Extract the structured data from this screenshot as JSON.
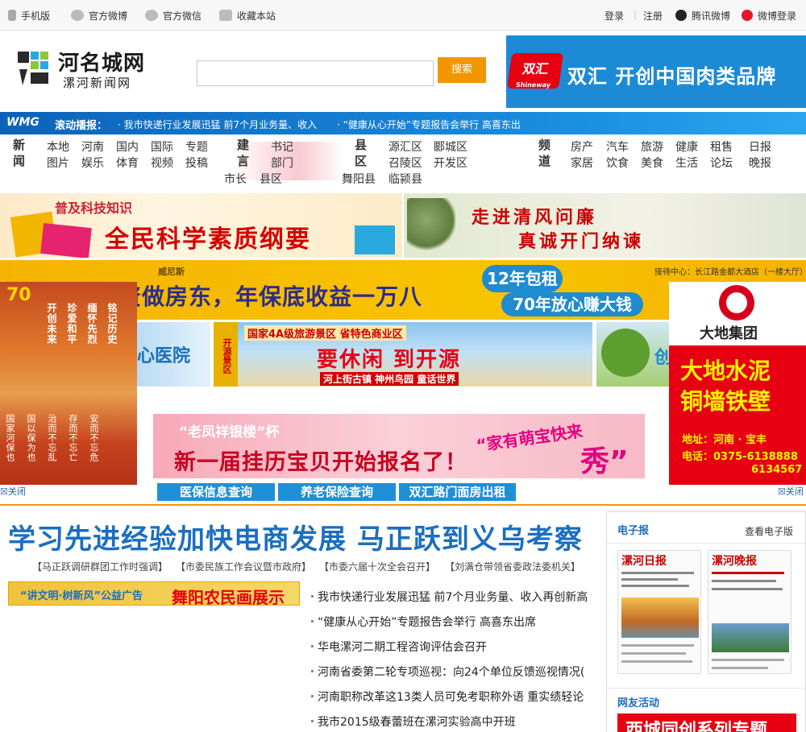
{
  "topbar": {
    "mobile": "手机版",
    "weibo": "官方微博",
    "wechat": "官方微信",
    "bookmark": "收藏本站",
    "login": "登录",
    "register": "注册",
    "tencent_weibo": "腾讯微博",
    "weibo_login": "微博登录"
  },
  "header": {
    "logo_title": "河名城网",
    "logo_subtitle": "漯河新闻网",
    "search_value": "",
    "search_button": "搜索",
    "ad_brand": "双汇",
    "ad_brand_en": "Shineway",
    "ad_text": "双汇  开创中国肉类品牌"
  },
  "ticker": {
    "logo": "WMG",
    "label": "滚动播报：",
    "items": [
      "· 我市快递行业发展迅猛  前7个月业务量、收入",
      "· “健康从心开始”专题报告会举行  高喜东出"
    ]
  },
  "nav": {
    "news": {
      "head": "新闻",
      "links": [
        "本地",
        "河南",
        "国内",
        "国际",
        "专题",
        "图片",
        "娱乐",
        "体育",
        "视频",
        "投稿"
      ]
    },
    "build": {
      "head": "建言",
      "links": [
        "书记",
        "部门",
        "市长",
        "县区"
      ]
    },
    "county": {
      "head": "县区",
      "links": [
        "源汇区",
        "郾城区",
        "召陵区",
        "开发区",
        "舞阳县",
        "临颍县"
      ]
    },
    "channel": {
      "head": "频道",
      "links": [
        "房产",
        "汽车",
        "旅游",
        "健康",
        "租售",
        "日报",
        "家居",
        "饮食",
        "美食",
        "生活",
        "论坛",
        "晚报"
      ]
    }
  },
  "banners": {
    "science_sub": "普及科技知识",
    "science_main": "全民科学素质纲要",
    "clean_l1": "走进清风问廉",
    "clean_l2": "真诚开门纳谏",
    "house_logo": "威尼斯",
    "house_main": "投资做房东，年保底收益一万八",
    "house_pill1": "12年包租",
    "house_pill2": "70年放心赚大钱",
    "house_reception": "接待中心：长江路金都大酒店（一楼大厅）",
    "hospital": "心医院",
    "tour_strip": "开源景区",
    "tour_header": "国家4A级旅游景区  省特色商业区",
    "tour_main": "要休闲  到开源",
    "tour_sub": "河上街古镇  神州鸟园  童话世界",
    "tree": "创",
    "baby_l1": "“老凤祥银楼”杯",
    "baby_l2": "新一届挂历宝贝开始报名了！",
    "baby_l3": "“家有萌宝快来",
    "baby_l4": "秀”"
  },
  "ad_left": {
    "seventy": "70",
    "cols": [
      "铭记历史",
      "缅怀先烈",
      "珍爱和平",
      "开创未来"
    ],
    "cols2": [
      "国家河保也",
      "国以保为也",
      "治而不忘乱",
      "存而不忘亡",
      "安而不忘危"
    ]
  },
  "ad_right": {
    "group": "大地集团",
    "big": "大地水泥 铜墙铁壁",
    "big1": "大地水泥",
    "big2": "铜墙铁壁",
    "addr": "地址：河南 · 宝丰",
    "tel": "电话：0375-6138888",
    "tel2": "6134567"
  },
  "quick": {
    "btn1": "医保信息查询",
    "btn2": "养老保险查询",
    "btn3": "双汇路门面房出租",
    "close_left": "☒关闭",
    "close_right": "☒关闭"
  },
  "main": {
    "headline": "学习先进经验加快电商发展  马正跃到义乌考察",
    "sub_links": [
      "【马正跃调研群团工作时强调】",
      "【市委民族工作会议暨市政府】",
      "【市委六届十次全会召开】",
      "【刘满仓带领省委政法委机关】"
    ],
    "paint_ad_a": "“讲文明·树新风”公益广告",
    "paint_ad_b": "舞阳农民画展示",
    "news": [
      "我市快递行业发展迅猛 前7个月业务量、收入再创新高",
      "“健康从心开始”专题报告会举行 高喜东出席",
      "华电漯河二期工程咨询评估会召开",
      "河南省委第二轮专项巡视：向24个单位反馈巡视情况(",
      "河南职称改革这13类人员可免考职称外语 重实绩轻论",
      "我市2015级春蕾班在漯河实验高中开班"
    ]
  },
  "side": {
    "epaper": "电子报",
    "view_epaper": "查看电子版",
    "paper1": "漯河日报",
    "paper2": "漯河晚报",
    "activity": "网友活动",
    "activity_banner": "西城同创系列专题"
  }
}
